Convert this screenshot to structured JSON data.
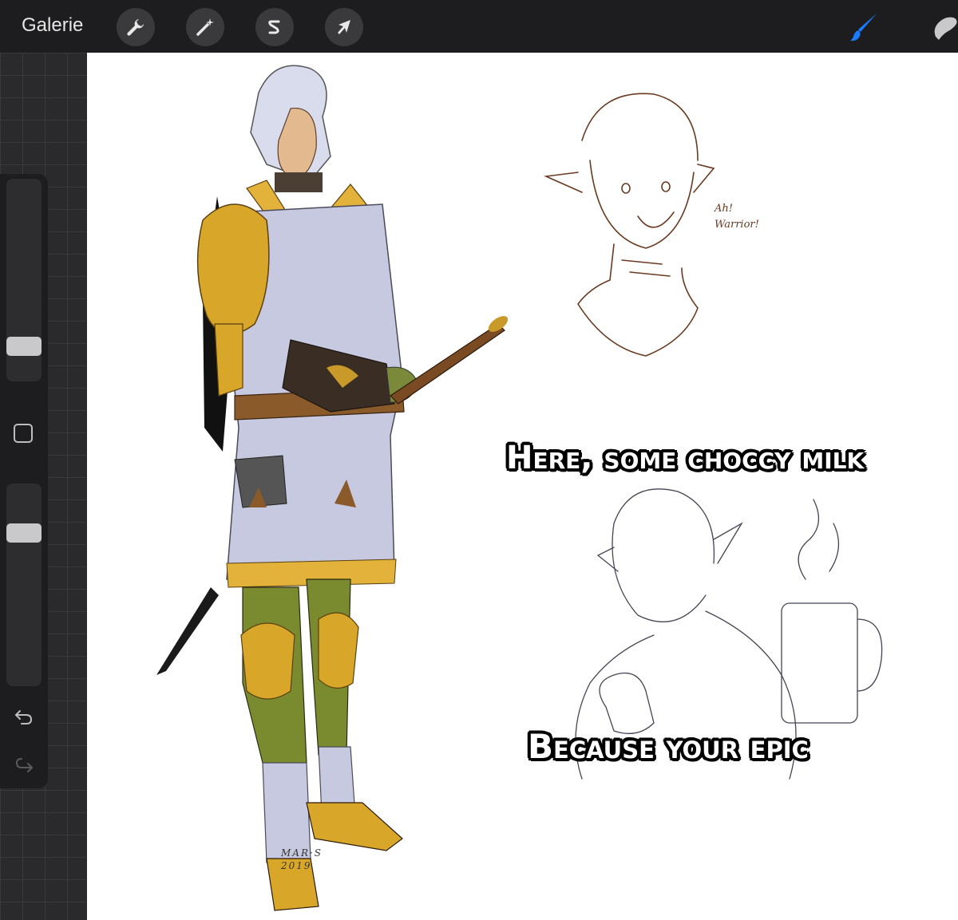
{
  "app": {
    "gallery_label": "Galerie"
  },
  "toolbar": {
    "left_tools": [
      {
        "name": "actions",
        "icon": "wrench-icon"
      },
      {
        "name": "adjustments",
        "icon": "magic-wand-icon"
      },
      {
        "name": "selection",
        "icon": "selection-s-icon"
      },
      {
        "name": "transform",
        "icon": "arrow-cursor-icon"
      }
    ],
    "right_tools": [
      {
        "name": "brush",
        "icon": "brush-icon",
        "active": true
      },
      {
        "name": "smudge",
        "icon": "smudge-icon",
        "active": false
      }
    ],
    "active_color": "#1a7cff"
  },
  "sidebar": {
    "brush_size_level": 0.25,
    "opacity_level": 0.75,
    "undo_icon": "undo-icon",
    "redo_icon": "redo-icon"
  },
  "canvas": {
    "sketch_note_line1": "Ah!",
    "sketch_note_line2": "Warrior!",
    "meme_top": "Here, some choccy milk",
    "meme_bottom": "Because your epic",
    "signature_line1": "MAR·S",
    "signature_line2": "2019"
  }
}
